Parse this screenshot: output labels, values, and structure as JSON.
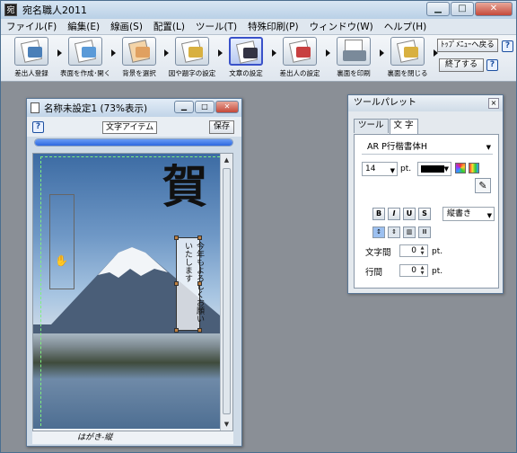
{
  "app": {
    "title": "宛名職人2011",
    "icon_char": "宛"
  },
  "caption_buttons": {
    "minimize": "▁",
    "maximize": "□",
    "close": "✕"
  },
  "menu": [
    "ファイル(F)",
    "編集(E)",
    "線画(S)",
    "配置(L)",
    "ツール(T)",
    "特殊印刷(P)",
    "ウィンドウ(W)",
    "ヘルプ(H)"
  ],
  "toolbar": {
    "steps": [
      {
        "label": "差出人登録",
        "icon": "card-register-icon",
        "color": "#4a7fb8"
      },
      {
        "label": "表面を作成･開く",
        "icon": "card-open-icon",
        "color": "#5a9ad8"
      },
      {
        "label": "背景を選択",
        "icon": "background-icon",
        "color": "#e0a060"
      },
      {
        "label": "図や題字の設定",
        "icon": "picture-icon",
        "color": "#d8b040"
      },
      {
        "label": "文章の設定",
        "icon": "text-settings-icon",
        "color": "#3a52c9",
        "selected": true
      },
      {
        "label": "差出人の設定",
        "icon": "sender-icon",
        "color": "#c84040"
      },
      {
        "label": "裏面を印刷",
        "icon": "printer-icon",
        "color": "#7a8a9a"
      },
      {
        "label": "裏面を閉じる",
        "icon": "close-card-icon",
        "color": "#d8b040"
      }
    ],
    "top_menu_label": "ﾄｯﾌﾟﾒﾆｭｰへ戻る",
    "exit_label": "終了する",
    "help_label": "?"
  },
  "document": {
    "title": "名称未設定1 (73%表示)",
    "item_label": "文字アイテム",
    "save_label": "保存",
    "help_label": "?",
    "progress": 1.0,
    "status": "はがき-縦",
    "kanji": "賀",
    "greeting": "今年もよろしくお願いいたします"
  },
  "palette": {
    "title": "ツールパレット",
    "close": "×",
    "tabs": [
      "ツール",
      "文 字"
    ],
    "active_tab": 1,
    "font": "AR P行楷書体H",
    "size": "14",
    "unit": "pt.",
    "text_color": "#000000",
    "format_buttons": [
      "B",
      "I",
      "U",
      "S"
    ],
    "direction": "縦書き",
    "align_buttons": [
      "↕",
      "⇕",
      "▥",
      "Ⅲ"
    ],
    "char_spacing_label": "文字間",
    "char_spacing": "0",
    "line_spacing_label": "行間",
    "line_spacing": "0",
    "dropper": "✎"
  }
}
